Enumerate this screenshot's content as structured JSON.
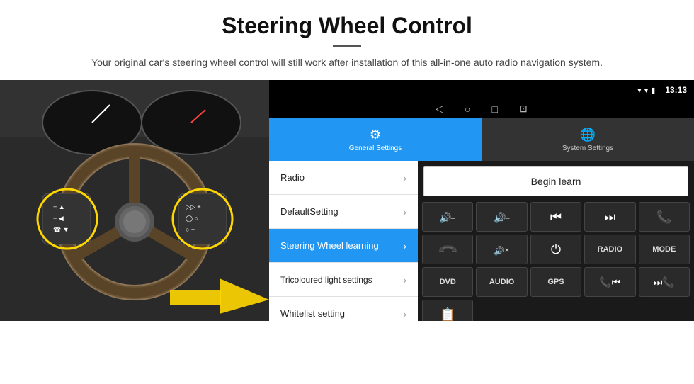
{
  "header": {
    "title": "Steering Wheel Control",
    "divider": true,
    "subtitle": "Your original car's steering wheel control will still work after installation of this all-in-one auto radio navigation system."
  },
  "statusBar": {
    "wifi_icon": "▾",
    "signal_icon": "▾",
    "battery_icon": "▮",
    "time": "13:13"
  },
  "navBar": {
    "back": "◁",
    "home": "○",
    "recent": "□",
    "screenshot": "⊡"
  },
  "tabs": [
    {
      "id": "general",
      "icon": "⚙",
      "label": "General Settings",
      "active": true
    },
    {
      "id": "system",
      "icon": "🌐",
      "label": "System Settings",
      "active": false
    }
  ],
  "menuItems": [
    {
      "id": "radio",
      "label": "Radio",
      "active": false
    },
    {
      "id": "default",
      "label": "DefaultSetting",
      "active": false
    },
    {
      "id": "steering",
      "label": "Steering Wheel learning",
      "active": true
    },
    {
      "id": "tricoloured",
      "label": "Tricoloured light settings",
      "active": false
    },
    {
      "id": "whitelist",
      "label": "Whitelist setting",
      "active": false
    }
  ],
  "controlPanel": {
    "beginLearn": "Begin learn",
    "buttons": [
      {
        "icon": "🔊+",
        "type": "icon",
        "row": 1
      },
      {
        "icon": "🔊−",
        "type": "icon",
        "row": 1
      },
      {
        "icon": "⏮",
        "type": "icon",
        "row": 1
      },
      {
        "icon": "⏭",
        "type": "icon",
        "row": 1
      },
      {
        "icon": "📞",
        "type": "icon",
        "row": 1
      },
      {
        "icon": "↩",
        "type": "icon",
        "row": 2
      },
      {
        "icon": "🔊×",
        "type": "icon",
        "row": 2
      },
      {
        "icon": "⏻",
        "type": "icon",
        "row": 2
      },
      {
        "text": "RADIO",
        "type": "text",
        "row": 2
      },
      {
        "text": "MODE",
        "type": "text",
        "row": 2
      },
      {
        "text": "DVD",
        "type": "text",
        "row": 3
      },
      {
        "text": "AUDIO",
        "type": "text",
        "row": 3
      },
      {
        "text": "GPS",
        "type": "text",
        "row": 3
      },
      {
        "icon": "📞⏮",
        "type": "icon",
        "row": 3
      },
      {
        "icon": "⏭📞",
        "type": "icon",
        "row": 3
      },
      {
        "icon": "📋",
        "type": "icon",
        "row": 4
      }
    ]
  }
}
